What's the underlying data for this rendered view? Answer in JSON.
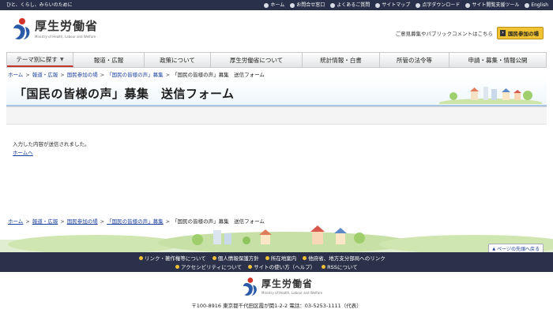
{
  "top_bar": {
    "tagline": "ひと、くらし、みらいのために",
    "links": [
      {
        "label": "ホーム",
        "icon": "home-icon"
      },
      {
        "label": "お問合せ窓口",
        "icon": "mail-icon"
      },
      {
        "label": "よくあるご質問",
        "icon": "question-icon"
      },
      {
        "label": "サイトマップ",
        "icon": "sitemap-icon"
      },
      {
        "label": "点字ダウンロード",
        "icon": "braille-icon"
      },
      {
        "label": "サイト閲覧支援ツール",
        "icon": "accessibility-icon"
      },
      {
        "label": "English",
        "icon": "globe-icon"
      }
    ]
  },
  "header": {
    "logo_title": "厚生労働省",
    "logo_subtitle": "Ministry of Health, Labour and Welfare",
    "comment_text": "ご意見募集やパブリックコメントはこちら",
    "comment_button": "国民参加の場"
  },
  "global_nav": [
    {
      "label": "テーマ別に探す",
      "dropdown": true
    },
    {
      "label": "報道・広報",
      "dropdown": false
    },
    {
      "label": "政策について",
      "dropdown": false
    },
    {
      "label": "厚生労働省について",
      "dropdown": false
    },
    {
      "label": "統計情報・白書",
      "dropdown": false
    },
    {
      "label": "所管の法令等",
      "dropdown": false
    },
    {
      "label": "申請・募集・情報公開",
      "dropdown": false
    }
  ],
  "breadcrumb_top": [
    {
      "label": "ホーム",
      "link": true
    },
    {
      "label": "報道・広報",
      "link": true
    },
    {
      "label": "国民参加の場",
      "link": true
    },
    {
      "label": "「国民の皆様の声」募集",
      "link": true
    },
    {
      "label": "「国民の皆様の声」募集　送信フォーム",
      "link": false
    }
  ],
  "page_title": "「国民の皆様の声」募集　送信フォーム",
  "content": {
    "message": "入力した内容が送信されました。",
    "home_link": "ホームへ"
  },
  "breadcrumb_bottom": [
    {
      "label": "ホーム",
      "link": true
    },
    {
      "label": "報道・広報",
      "link": true
    },
    {
      "label": "国民参加の場",
      "link": true
    },
    {
      "label": "「国民の皆様の声」募集",
      "link": true
    },
    {
      "label": "「国民の皆様の声」募集　送信フォーム",
      "link": false
    }
  ],
  "to_top": "ページの先頭へ戻る",
  "footer_links_row1": [
    "リンク・著作権等について",
    "個人情報保護方針",
    "所在地案内",
    "他府省、地方支分部局へのリンク"
  ],
  "footer_links_row2": [
    "アクセシビリティについて",
    "サイトの使い方（ヘルプ）",
    "RSSについて"
  ],
  "footer": {
    "logo_title": "厚生労働省",
    "logo_subtitle": "Ministry of Health, Labour and Welfare",
    "address": "〒100-8916 東京都千代田区霞が関1-2-2 電話：03-5253-1111（代表）"
  },
  "colors": {
    "top_bar": "#28304a",
    "accent_red": "#c3342b",
    "logo_blue": "#2b5aa8",
    "button_yellow": "#f1c232",
    "link_blue": "#1a3f9c"
  }
}
